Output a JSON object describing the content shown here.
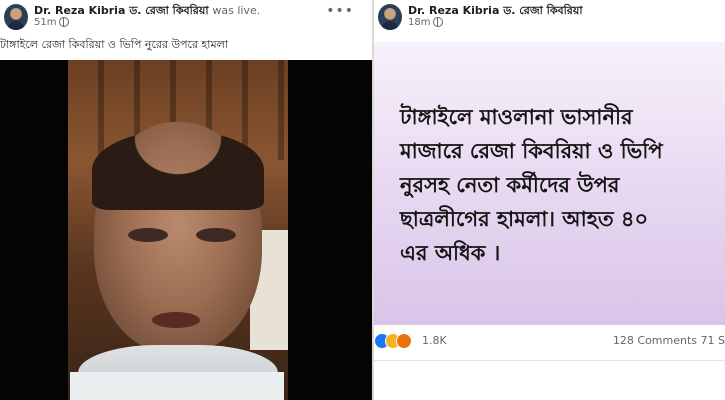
{
  "left_post": {
    "author": "Dr. Reza Kibria ড. রেজা কিবরিয়া",
    "status": "was live.",
    "time": "51m",
    "more_label": "•••",
    "caption": "টাঙ্গাইলে রেজা কিবরিয়া ও ভিপি নুরের উপরে হামলা"
  },
  "right_post": {
    "author": "Dr. Reza Kibria ড. রেজা কিবরিয়া",
    "time": "18m",
    "text": "টাঙ্গাইলে মাওলানা ভাসানীর\nমাজারে রেজা কিবরিয়া ও ভিপি\nনুরসহ নেতা কর্মীদের উপর\nছাত্রলীগের হামলা। আহত ৪০\nএর অধিক ।",
    "reaction_count": "1.8K",
    "comments_shares": "128 Comments  71 S",
    "reactions": [
      "like-icon",
      "sad-icon",
      "angry-icon"
    ]
  },
  "colors": {
    "post_bg_top": "#f7f1fa",
    "post_bg_bottom": "#d8c4e8",
    "like_blue": "#1877f2"
  }
}
